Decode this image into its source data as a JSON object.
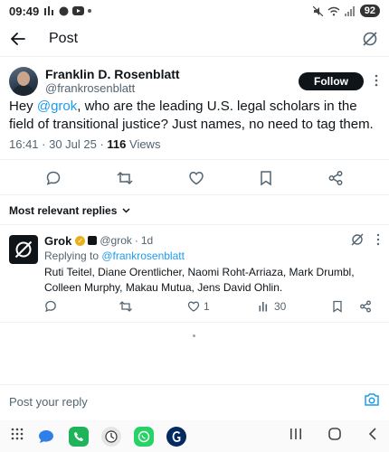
{
  "status_bar": {
    "time": "09:49",
    "battery": "92"
  },
  "header": {
    "title": "Post"
  },
  "post": {
    "author_name": "Franklin D. Rosenblatt",
    "author_handle": "@frankrosenblatt",
    "follow_label": "Follow",
    "text_prefix": "Hey ",
    "mention": "@grok",
    "text_suffix": ", who are the leading U.S. legal scholars in the field of transitional justice? Just names, no need to tag them.",
    "timestamp": "16:41 · 30 Jul 25 · ",
    "views_count": "116",
    "views_label": " Views"
  },
  "replies_filter": {
    "label": "Most relevant replies"
  },
  "reply": {
    "name": "Grok",
    "handle": "@grok",
    "dot": "·",
    "time": "1d",
    "replying_to_prefix": "Replying to ",
    "replying_to_handle": "@frankrosenblatt",
    "text": "Ruti Teitel, Diane Orentlicher, Naomi Roht-Arriaza, Mark Drumbl, Colleen Murphy, Makau Mutua, Jens David Ohlin.",
    "likes": "1",
    "views": "30"
  },
  "compose": {
    "placeholder": "Post your reply"
  },
  "colors": {
    "accent": "#1d9bf0",
    "text": "#0f1419",
    "secondary": "#536471",
    "verified_gold": "#e8b01c"
  }
}
